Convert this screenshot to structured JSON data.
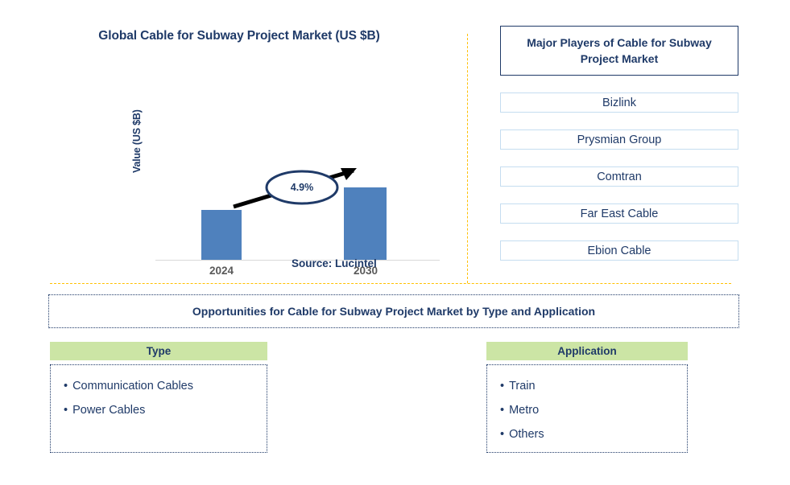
{
  "chart_panel": {
    "title": "Global Cable for Subway Project Market (US $B)",
    "y_axis_label": "Value (US $B)",
    "cagr_label": "4.9%",
    "source": "Source: Lucintel"
  },
  "chart_data": {
    "type": "bar",
    "title": "Global Cable for Subway Project Market (US $B)",
    "categories": [
      "2024",
      "2030"
    ],
    "values": [
      62,
      90
    ],
    "value_unit": "US $B",
    "xlabel": "",
    "ylabel": "Value (US $B)",
    "grid": false,
    "legend": "none",
    "annotations": [
      {
        "text": "4.9%",
        "type": "cagr-arrow",
        "from": "2024",
        "to": "2030"
      }
    ],
    "bar_color": "#4f81bd",
    "axis_color": "#d9d9d9",
    "tick_label_color": "#595959"
  },
  "players_panel": {
    "header": "Major Players of Cable for Subway Project Market",
    "items": [
      {
        "label": "Bizlink"
      },
      {
        "label": "Prysmian Group"
      },
      {
        "label": "Comtran"
      },
      {
        "label": "Far East Cable"
      },
      {
        "label": "Ebion Cable"
      }
    ]
  },
  "opportunities": {
    "title": "Opportunities for Cable for Subway Project Market by Type and Application",
    "type": {
      "header": "Type",
      "items": [
        {
          "bullet": "•",
          "label": "Communication Cables"
        },
        {
          "bullet": "•",
          "label": "Power Cables"
        }
      ]
    },
    "application": {
      "header": "Application",
      "items": [
        {
          "bullet": "•",
          "label": "Train"
        },
        {
          "bullet": "•",
          "label": "Metro"
        },
        {
          "bullet": "•",
          "label": "Others"
        }
      ]
    }
  },
  "colors": {
    "navy": "#1f3a68",
    "bar_blue": "#4f81bd",
    "divider_gold": "#ffc000",
    "header_green": "#cce5a5",
    "player_border": "#c5ddf0"
  }
}
